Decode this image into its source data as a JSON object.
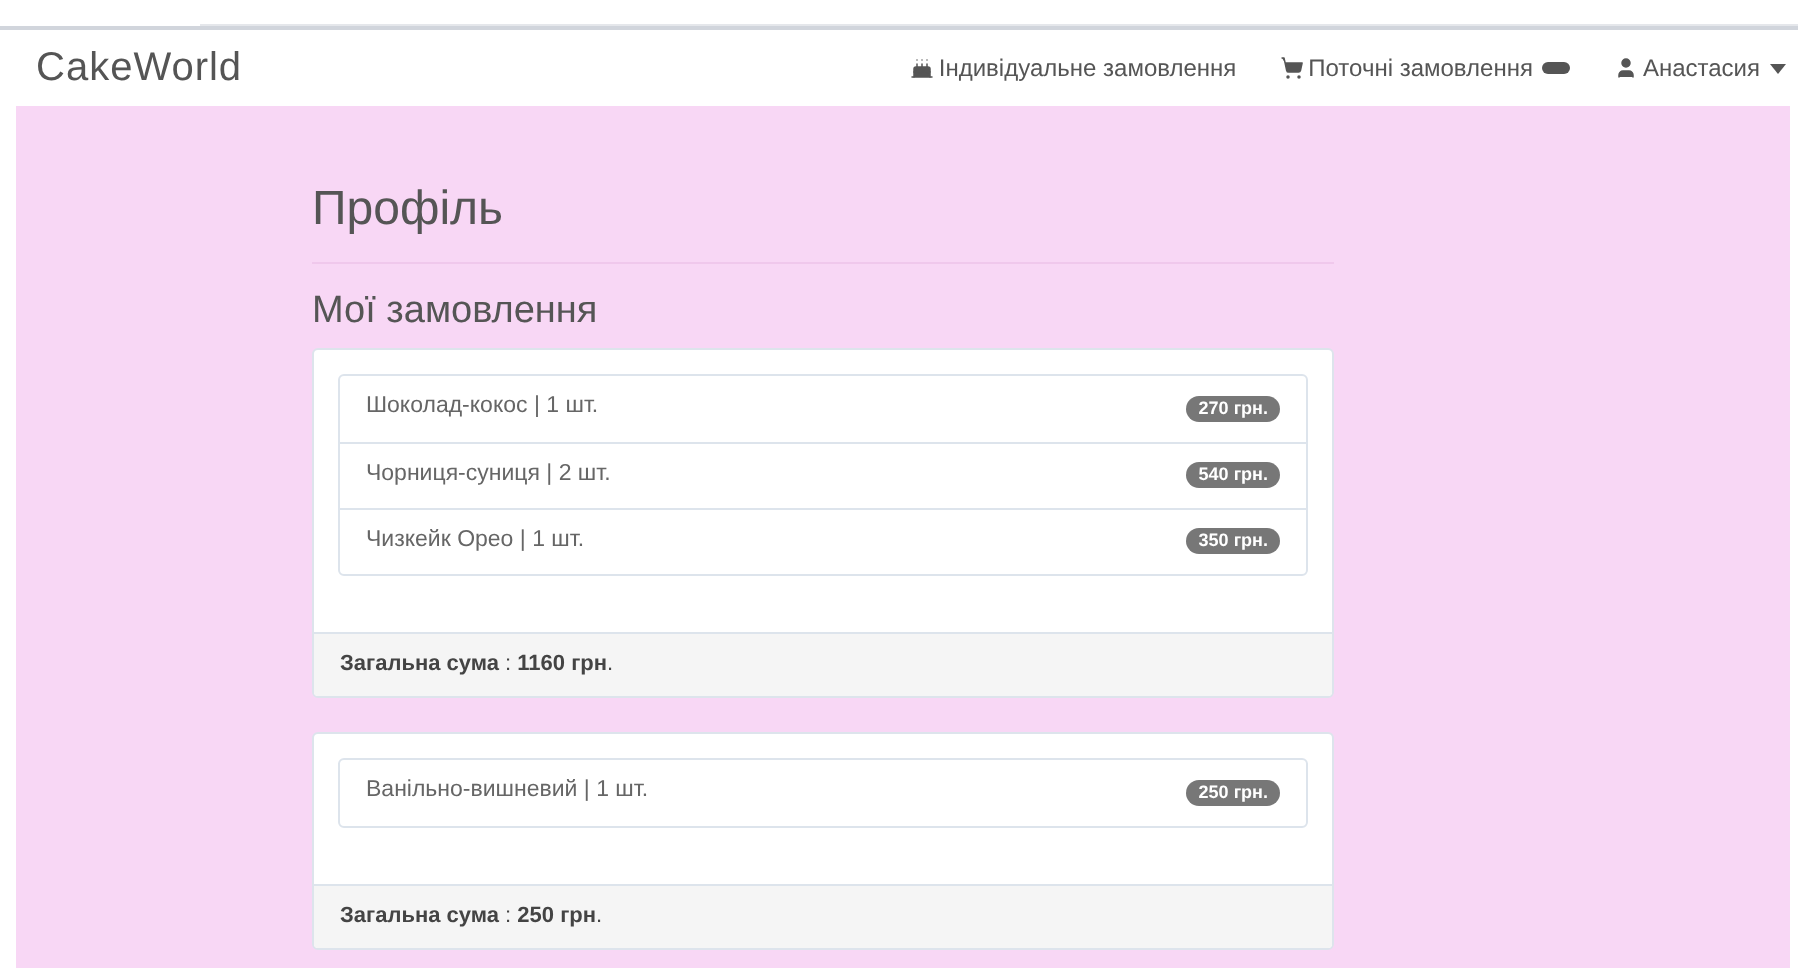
{
  "navbar": {
    "brand": "CakeWorld",
    "links": [
      {
        "kind": "cake",
        "label": "Індивідуальне замовлення"
      },
      {
        "kind": "cart",
        "label": "Поточні замовлення",
        "badge": true
      },
      {
        "kind": "user",
        "label": "Анастасия",
        "dropdown": true
      }
    ]
  },
  "page_title": "Профіль",
  "section_title": "Мої замовлення",
  "orders": [
    {
      "items": [
        {
          "text": "Шоколад-кокос | 1 шт.",
          "price": "270 грн."
        },
        {
          "text": "Чорниця-суниця | 2 шт.",
          "price": "540 грн."
        },
        {
          "text": "Чизкейк Орео | 1 шт.",
          "price": "350 грн."
        }
      ],
      "total": "**Загальна сума** : **1160 грн**."
    },
    {
      "items": [
        {
          "text": "Ванільно-вишневий | 1 шт.",
          "price": "250 грн."
        }
      ],
      "total": "**Загальна сума** : **250 грн**."
    }
  ]
}
